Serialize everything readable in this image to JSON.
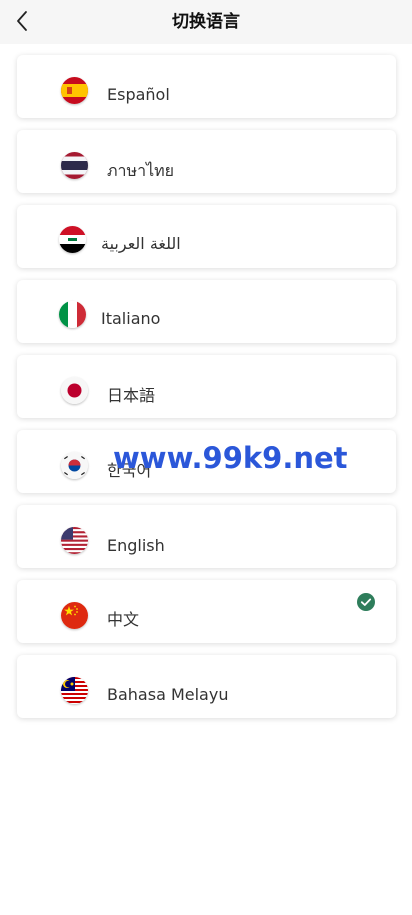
{
  "header": {
    "title": "切换语言",
    "back_icon": "chevron-left-icon"
  },
  "languages": [
    {
      "label": "Español",
      "flag": "spain-flag-icon",
      "selected": false
    },
    {
      "label": "ภาษาไทย",
      "flag": "thailand-flag-icon",
      "selected": false
    },
    {
      "label": "اللغة العربية",
      "flag": "iraq-flag-icon",
      "selected": false
    },
    {
      "label": "Italiano",
      "flag": "italy-flag-icon",
      "selected": false
    },
    {
      "label": "日本語",
      "flag": "japan-flag-icon",
      "selected": false
    },
    {
      "label": "한국어",
      "flag": "korea-flag-icon",
      "selected": false
    },
    {
      "label": "English",
      "flag": "usa-flag-icon",
      "selected": false
    },
    {
      "label": "中文",
      "flag": "china-flag-icon",
      "selected": true
    },
    {
      "label": "Bahasa Melayu",
      "flag": "malaysia-flag-icon",
      "selected": false
    }
  ],
  "watermark": {
    "text": "www.99k9.net"
  },
  "colors": {
    "accent_check": "#2e7d5b",
    "watermark": "#2b57d9",
    "header_bg": "#f6f6f6"
  }
}
